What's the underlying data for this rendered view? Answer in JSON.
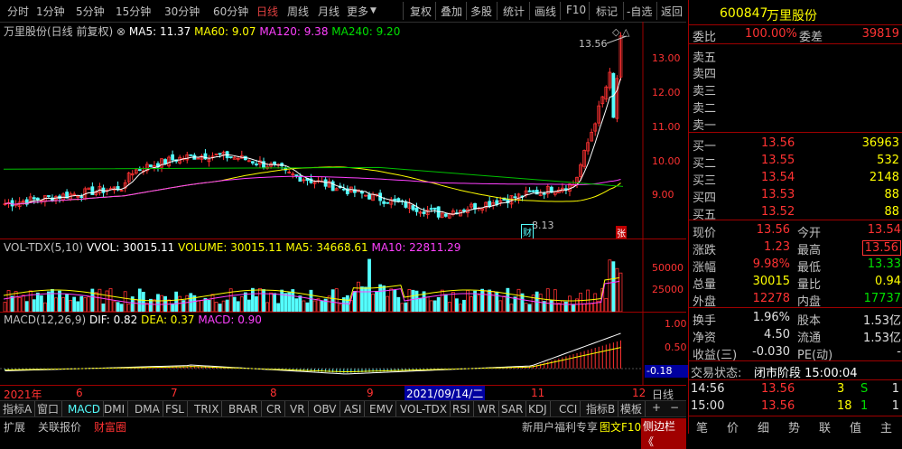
{
  "toolbar": {
    "periods": [
      "分时",
      "1分钟",
      "5分钟",
      "15分钟",
      "30分钟",
      "60分钟",
      "日线",
      "周线",
      "月线",
      "更多"
    ],
    "selected_period": "日线",
    "tools": [
      "复权",
      "叠加",
      "多股",
      "统计",
      "画线",
      "F10",
      "标记",
      "-自选",
      "返回"
    ]
  },
  "main_chart": {
    "stock_label": "万里股份(日线 前复权)",
    "ma5": "MA5: 11.37",
    "ma60": "MA60: 9.07",
    "ma120": "MA120: 9.38",
    "ma240": "MA240: 9.20",
    "high_label": "13.56",
    "low_label": "8.13",
    "marker_cai": "财",
    "marker_zhang": "张",
    "y_ticks": [
      "13.00",
      "12.00",
      "11.00",
      "10.00",
      "9.00"
    ]
  },
  "vol_chart": {
    "title": "VOL-TDX(5,10)",
    "vvol": "VVOL: 30015.11",
    "volume": "VOLUME: 30015.11",
    "ma5": "MA5: 34668.61",
    "ma10": "MA10: 22811.29",
    "y_ticks": [
      "50000",
      "25000"
    ]
  },
  "macd_chart": {
    "title": "MACD(12,26,9)",
    "dif": "DIF: 0.82",
    "dea": "DEA: 0.37",
    "macd": "MACD: 0.90",
    "y_ticks": [
      "1.00",
      "0.50"
    ],
    "cursor_value": "-0.18"
  },
  "date_axis": {
    "labels": [
      "2021年",
      "6",
      "7",
      "8",
      "9",
      "11",
      "12"
    ],
    "highlight": "2021/09/14/二",
    "period_button": "日线"
  },
  "indicator_tabs": [
    "指标A",
    "窗口",
    "MACD",
    "DMI",
    "DMA",
    "FSL",
    "TRIX",
    "BRAR",
    "CR",
    "VR",
    "OBV",
    "ASI",
    "EMV",
    "VOL-TDX",
    "RSI",
    "WR",
    "SAR",
    "KDJ",
    "CCI",
    "指标B",
    "模板"
  ],
  "bottom_tabs": [
    "扩展",
    "关联报价",
    "财富圈"
  ],
  "bottom_right": [
    "新用户福利专享",
    "图文F10",
    "侧边栏 《"
  ],
  "quote": {
    "code": "600847",
    "name": "万里股份",
    "weibi_label": "委比",
    "weibi": "100.00%",
    "weicha_label": "委差",
    "weicha": "39819",
    "sells": [
      "卖五",
      "卖四",
      "卖三",
      "卖二",
      "卖一"
    ],
    "buys": [
      {
        "label": "买一",
        "price": "13.56",
        "vol": "36963"
      },
      {
        "label": "买二",
        "price": "13.55",
        "vol": "532"
      },
      {
        "label": "买三",
        "price": "13.54",
        "vol": "2148"
      },
      {
        "label": "买四",
        "price": "13.53",
        "vol": "88"
      },
      {
        "label": "买五",
        "price": "13.52",
        "vol": "88"
      }
    ],
    "stats": [
      {
        "l1": "现价",
        "v1": "13.56",
        "l2": "今开",
        "v2": "13.54"
      },
      {
        "l1": "涨跌",
        "v1": "1.23",
        "l2": "最高",
        "v2": "13.56"
      },
      {
        "l1": "涨幅",
        "v1": "9.98%",
        "l2": "最低",
        "v2": "13.33"
      },
      {
        "l1": "总量",
        "v1": "30015",
        "l2": "量比",
        "v2": "0.94"
      },
      {
        "l1": "外盘",
        "v1": "12278",
        "l2": "内盘",
        "v2": "17737"
      }
    ],
    "stats2": [
      {
        "l1": "换手",
        "v1": "1.96%",
        "l2": "股本",
        "v2": "1.53亿"
      },
      {
        "l1": "净资",
        "v1": "4.50",
        "l2": "流通",
        "v2": "1.53亿"
      },
      {
        "l1": "收益(三)",
        "v1": "-0.030",
        "l2": "PE(动)",
        "v2": "-"
      }
    ],
    "status_label": "交易状态:",
    "status": "闭市阶段 15:00:04",
    "ticks": [
      {
        "time": "14:56",
        "price": "13.56",
        "vol": "3",
        "bs": "S",
        "n": "1"
      },
      {
        "time": "15:00",
        "price": "13.56",
        "vol": "18",
        "bs": "1",
        "n": "1"
      }
    ],
    "bottom_tabs": [
      "笔",
      "价",
      "细",
      "势",
      "联",
      "值",
      "主"
    ]
  },
  "colors": {
    "up": "#ff3232",
    "down": "#54ffff",
    "ma5": "#ffffff",
    "ma60": "#ffff00",
    "ma120": "#ff40ff",
    "ma240": "#00c000"
  }
}
